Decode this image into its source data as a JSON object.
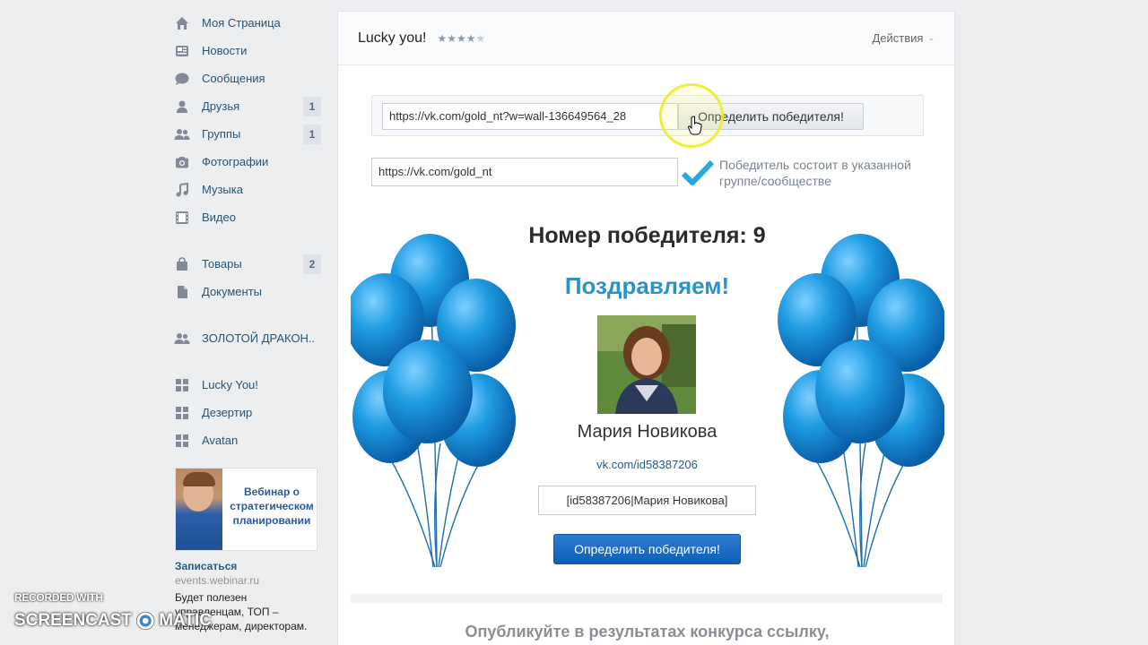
{
  "sidebar": {
    "items": [
      {
        "label": "Моя Страница",
        "icon": "home-icon"
      },
      {
        "label": "Новости",
        "icon": "news-icon"
      },
      {
        "label": "Сообщения",
        "icon": "messages-icon"
      },
      {
        "label": "Друзья",
        "icon": "friends-icon",
        "count": "1"
      },
      {
        "label": "Группы",
        "icon": "groups-icon",
        "count": "1"
      },
      {
        "label": "Фотографии",
        "icon": "camera-icon"
      },
      {
        "label": "Музыка",
        "icon": "music-icon"
      },
      {
        "label": "Видео",
        "icon": "video-icon"
      },
      {
        "label": "Товары",
        "icon": "bag-icon",
        "count": "2"
      },
      {
        "label": "Документы",
        "icon": "document-icon"
      },
      {
        "label": "ЗОЛОТОЙ ДРАКОН..",
        "icon": "group-icon"
      },
      {
        "label": "Lucky You!",
        "icon": "app-icon"
      },
      {
        "label": "Дезертир",
        "icon": "app-icon"
      },
      {
        "label": "Avatan",
        "icon": "app-icon"
      }
    ]
  },
  "ad": {
    "image_text": "Вебинар о стратегическом планировании",
    "cta": "Записаться",
    "domain": "events.webinar.ru",
    "description": "Будет полезен управленцам, ТОП – менеджерам, директорам."
  },
  "app": {
    "title": "Lucky you!",
    "stars_filled": "★★★★",
    "stars_empty": "★",
    "actions_label": "Действия"
  },
  "form": {
    "post_url": "https://vk.com/gold_nt?w=wall-136649564_28",
    "determine_button": "Определить победителя!",
    "group_url": "https://vk.com/gold_nt",
    "group_check_note": "Победитель состоит в указанной группе/сообществе"
  },
  "result": {
    "winner_number": "Номер победителя: 9",
    "congrats": "Поздравляем!",
    "winner_name": "Мария Новикова",
    "winner_link": "vk.com/id58387206",
    "winner_code": "[id58387206|Мария Новикова]",
    "determine_again_button": "Определить победителя!",
    "publish_note": "Опубликуйте в результатах конкурса ссылку,"
  },
  "watermark": {
    "top": "RECORDED WITH",
    "left": "SCREENCAST",
    "right": "MATIC"
  },
  "colors": {
    "accent": "#2a5885",
    "congrats": "#2a93c8",
    "button_blue": "#1565c0",
    "balloon": "#1e9be3"
  }
}
